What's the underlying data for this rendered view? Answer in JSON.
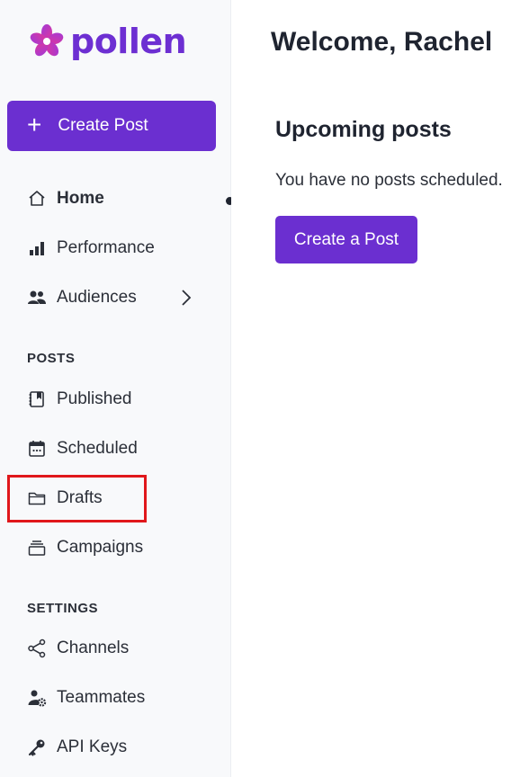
{
  "brand": {
    "name": "pollen",
    "color": "#6d2fd2",
    "logo_icon": "pollen-flower-logo"
  },
  "sidebar": {
    "create_button": {
      "label": "Create Post",
      "icon": "plus-icon",
      "color": "#6b2fd0"
    },
    "main_items": [
      {
        "label": "Home",
        "icon": "home-icon",
        "active": true
      },
      {
        "label": "Performance",
        "icon": "bar-chart-icon"
      },
      {
        "label": "Audiences",
        "icon": "people-icon",
        "has_submenu": true
      }
    ],
    "posts_section": {
      "heading": "POSTS",
      "items": [
        {
          "label": "Published",
          "icon": "published-book-icon"
        },
        {
          "label": "Scheduled",
          "icon": "calendar-icon"
        },
        {
          "label": "Drafts",
          "icon": "folder-icon",
          "highlighted": true
        },
        {
          "label": "Campaigns",
          "icon": "stack-icon"
        }
      ]
    },
    "settings_section": {
      "heading": "SETTINGS",
      "items": [
        {
          "label": "Channels",
          "icon": "share-icon"
        },
        {
          "label": "Teammates",
          "icon": "user-gear-icon"
        },
        {
          "label": "API Keys",
          "icon": "key-icon"
        }
      ]
    }
  },
  "main": {
    "welcome": "Welcome, Rachel",
    "upcoming_heading": "Upcoming posts",
    "empty_message": "You have no posts scheduled.",
    "create_button_label": "Create a Post"
  },
  "colors": {
    "accent": "#6b2fd0",
    "highlight_box": "#e0171b",
    "sidebar_bg": "#f8f9fb"
  }
}
